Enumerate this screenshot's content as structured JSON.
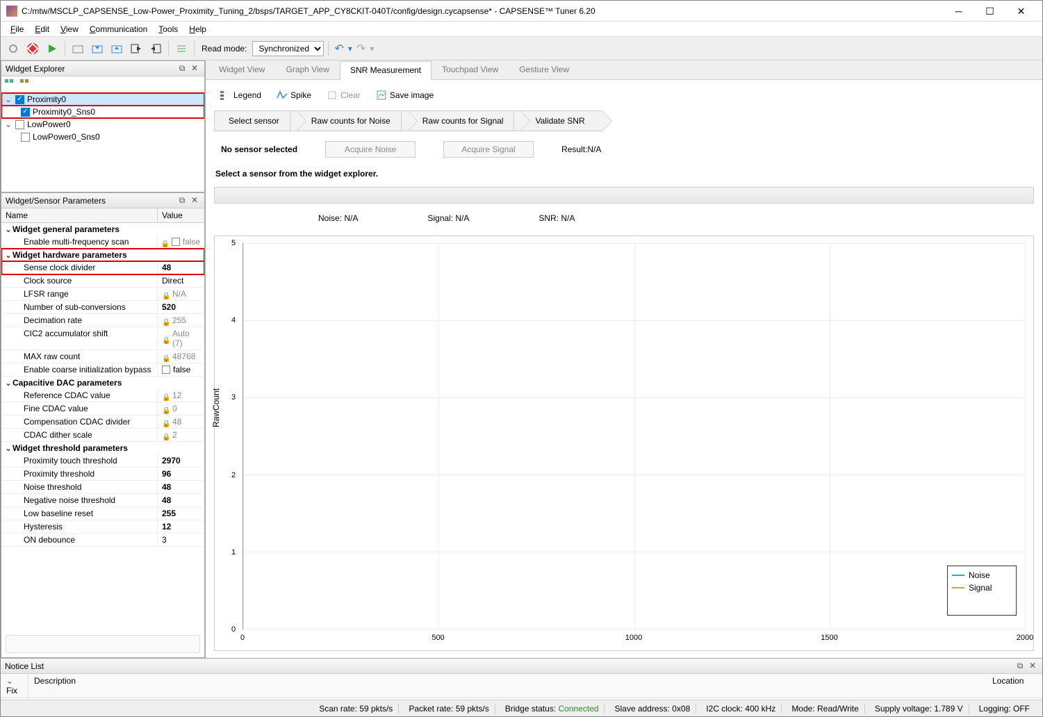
{
  "titlebar": {
    "title": "C:/mtw/MSCLP_CAPSENSE_Low-Power_Proximity_Tuning_2/bsps/TARGET_APP_CY8CKIT-040T/config/design.cycapsense* - CAPSENSE™ Tuner 6.20"
  },
  "menu": {
    "file": "File",
    "edit": "Edit",
    "view": "View",
    "comm": "Communication",
    "tools": "Tools",
    "help": "Help"
  },
  "toolbar": {
    "read_mode_label": "Read mode:",
    "read_mode_value": "Synchronized"
  },
  "widget_explorer": {
    "title": "Widget Explorer",
    "items": [
      {
        "label": "Proximity0",
        "checked": true,
        "sel": true,
        "hl": true
      },
      {
        "label": "Proximity0_Sns0",
        "checked": true,
        "indent": 1,
        "hl": true
      },
      {
        "label": "LowPower0",
        "checked": false
      },
      {
        "label": "LowPower0_Sns0",
        "checked": false,
        "indent": 1
      }
    ]
  },
  "params": {
    "title": "Widget/Sensor Parameters",
    "col_name": "Name",
    "col_value": "Value",
    "groups": [
      {
        "label": "Widget general parameters",
        "rows": [
          {
            "name": "Enable multi-frequency scan",
            "value": "false",
            "locked": true,
            "cb": true
          }
        ]
      },
      {
        "label": "Widget hardware parameters",
        "hl": true,
        "rows": [
          {
            "name": "Sense clock divider",
            "value": "48",
            "bold": true,
            "hl": true
          },
          {
            "name": "Clock source",
            "value": "Direct"
          },
          {
            "name": "LFSR range",
            "value": "N/A",
            "locked": true
          },
          {
            "name": "Number of sub-conversions",
            "value": "520",
            "bold": true
          },
          {
            "name": "Decimation rate",
            "value": "255",
            "locked": true
          },
          {
            "name": "CIC2 accumulator shift",
            "value": "Auto (7)",
            "locked": true
          },
          {
            "name": "MAX raw count",
            "value": "48768",
            "locked": true
          },
          {
            "name": "Enable coarse initialization bypass",
            "value": "false",
            "cb": true
          }
        ]
      },
      {
        "label": "Capacitive DAC parameters",
        "rows": [
          {
            "name": "Reference CDAC value",
            "value": "12",
            "locked": true
          },
          {
            "name": "Fine CDAC value",
            "value": "0",
            "locked": true
          },
          {
            "name": "Compensation CDAC divider",
            "value": "48",
            "locked": true
          },
          {
            "name": "CDAC dither scale",
            "value": "2",
            "locked": true
          }
        ]
      },
      {
        "label": "Widget threshold parameters",
        "rows": [
          {
            "name": "Proximity touch threshold",
            "value": "2970",
            "bold": true
          },
          {
            "name": "Proximity threshold",
            "value": "96",
            "bold": true
          },
          {
            "name": "Noise threshold",
            "value": "48",
            "bold": true
          },
          {
            "name": "Negative noise threshold",
            "value": "48",
            "bold": true
          },
          {
            "name": "Low baseline reset",
            "value": "255",
            "bold": true
          },
          {
            "name": "Hysteresis",
            "value": "12",
            "bold": true
          },
          {
            "name": "ON debounce",
            "value": "3"
          }
        ]
      }
    ]
  },
  "tabs": [
    "Widget View",
    "Graph View",
    "SNR Measurement",
    "Touchpad View",
    "Gesture View"
  ],
  "active_tab": 2,
  "snr": {
    "tb": {
      "legend": "Legend",
      "spike": "Spike",
      "clear": "Clear",
      "save": "Save image"
    },
    "steps": [
      "Select sensor",
      "Raw counts for Noise",
      "Raw counts for Signal",
      "Validate SNR"
    ],
    "no_sensor": "No sensor selected",
    "acq_noise": "Acquire Noise",
    "acq_signal": "Acquire Signal",
    "result": "Result:N/A",
    "msg": "Select a sensor from the widget explorer.",
    "noise": "Noise:  N/A",
    "signal": "Signal:  N/A",
    "snr": "SNR:  N/A",
    "legend_noise": "Noise",
    "legend_signal": "Signal",
    "ylabel": "RawCount"
  },
  "chart_data": {
    "type": "line",
    "title": "",
    "xlabel": "",
    "ylabel": "RawCount",
    "xlim": [
      0,
      2000
    ],
    "ylim": [
      0,
      5
    ],
    "xticks": [
      0,
      500,
      1000,
      1500,
      2000
    ],
    "yticks": [
      0,
      1,
      2,
      3,
      4,
      5
    ],
    "series": [
      {
        "name": "Noise",
        "values": [],
        "color": "#3aa0d8"
      },
      {
        "name": "Signal",
        "values": [],
        "color": "#e0a030"
      }
    ]
  },
  "notice": {
    "title": "Notice List",
    "fix": "Fix",
    "desc": "Description",
    "loc": "Location"
  },
  "status": {
    "scan_rate_lbl": "Scan rate:",
    "scan_rate": "59 pkts/s",
    "pkt_rate_lbl": "Packet rate:",
    "pkt_rate": "59 pkts/s",
    "bridge_lbl": "Bridge status:",
    "bridge": "Connected",
    "slave_lbl": "Slave address:",
    "slave": "0x08",
    "i2c_lbl": "I2C clock:",
    "i2c": "400 kHz",
    "mode_lbl": "Mode:",
    "mode": "Read/Write",
    "supply_lbl": "Supply voltage:",
    "supply": "1.789 V",
    "log_lbl": "Logging:",
    "log": "OFF"
  }
}
